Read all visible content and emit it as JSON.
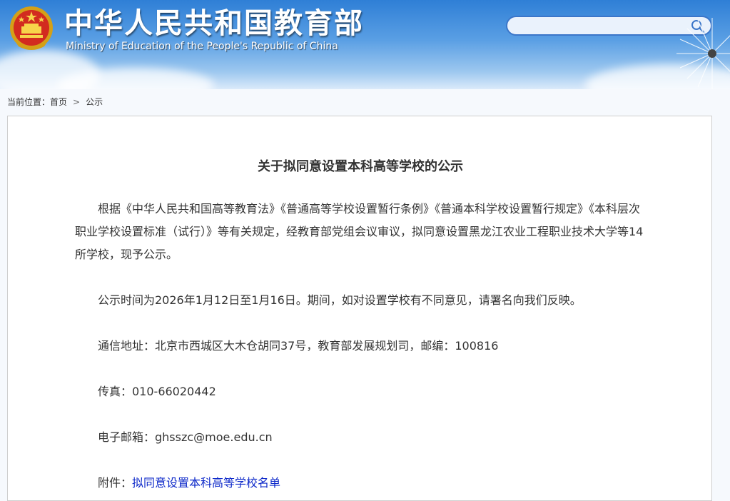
{
  "header": {
    "title": "中华人民共和国教育部",
    "subtitle": "Ministry of Education of the People's Republic of China",
    "search": {
      "placeholder": "",
      "value": ""
    }
  },
  "breadcrumb": {
    "prefix": "当前位置：",
    "home": "首页",
    "separator": ">",
    "current": "公示"
  },
  "article": {
    "title": "关于拟同意设置本科高等学校的公示",
    "paragraphs": [
      "根据《中华人民共和国高等教育法》《普通高等学校设置暂行条例》《普通本科学校设置暂行规定》《本科层次职业学校设置标准（试行）》等有关规定，经教育部党组会议审议，拟同意设置黑龙江农业工程职业技术大学等14所学校，现予公示。",
      "公示时间为2026年1月12日至1月16日。期间，如对设置学校有不同意见，请署名向我们反映。",
      "通信地址：北京市西城区大木仓胡同37号，教育部发展规划司，邮编：100816",
      "传真：010-66020442",
      "电子邮箱：ghsszc@moe.edu.cn"
    ],
    "attachment_label": "附件：",
    "attachment_link": "拟同意设置本科高等学校名单"
  },
  "colors": {
    "link": "#0b27c9",
    "text": "#333333",
    "banner_blue": "#2f7fd6"
  }
}
